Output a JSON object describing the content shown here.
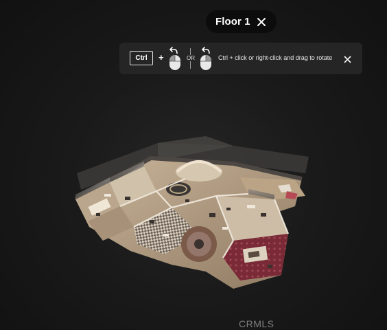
{
  "floor_selector": {
    "label": "Floor 1",
    "close_icon": "close-icon"
  },
  "rotate_hint": {
    "key_label": "Ctrl",
    "plus": "+",
    "or_label": "OR",
    "text": "Ctrl + click or right-click and drag to rotate",
    "icons": [
      "mouse-left-click-icon",
      "mouse-right-click-icon",
      "close-icon"
    ]
  },
  "watermark": {
    "text": "CRMLS"
  },
  "colors": {
    "background": "#1a1a1a",
    "pill_bg": "#0c0c0c",
    "hint_bg": "#262626",
    "text": "#ffffff"
  }
}
